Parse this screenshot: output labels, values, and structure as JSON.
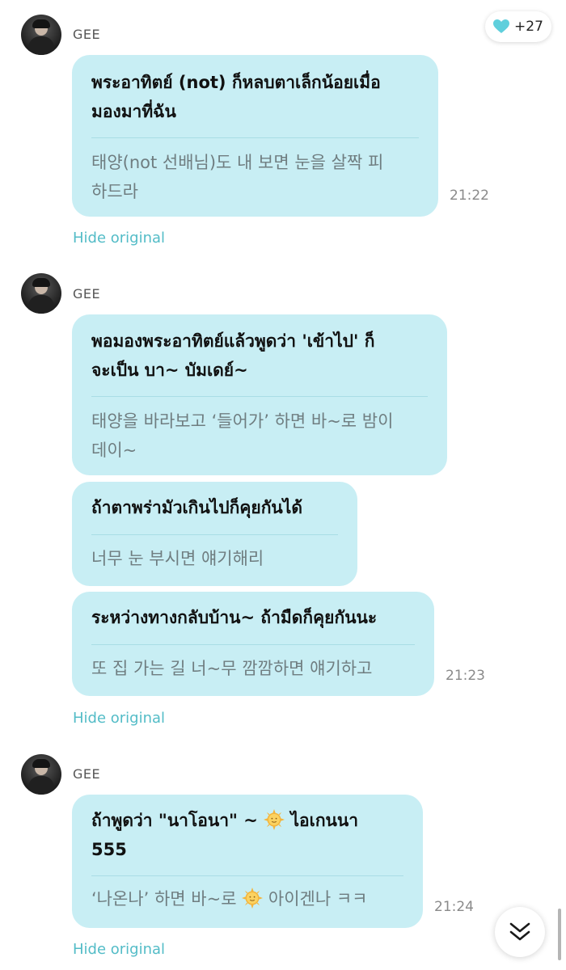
{
  "reactions": {
    "icon": "heart-icon",
    "color": "#5fcfdc",
    "count_label": "+27"
  },
  "hide_original_label": "Hide original",
  "messages": [
    {
      "author": "GEE",
      "time": "21:22",
      "bubbles": [
        {
          "translated": "พระอาทิตย์ (not) ก็หลบตาเล็กน้อยเมื่อ\nมองมาที่ฉัน",
          "original": "태양(not 선배님)도 내 보면 눈을 살짝 피\n하드라"
        }
      ]
    },
    {
      "author": "GEE",
      "time": "21:23",
      "bubbles": [
        {
          "translated": "พอมองพระอาทิตย์แล้วพูดว่า 'เข้าไป' ก็\nจะเป็น บา~ บัมเดย์~",
          "original": "태양을 바라보고 ‘들어가’ 하면 바~로 밤이\n데이~"
        },
        {
          "translated": "ถ้าตาพร่ามัวเกินไปก็คุยกันได้",
          "original": "너무 눈 부시면 얘기해리"
        },
        {
          "translated": "ระหว่างทางกลับบ้าน~ ถ้ามืดก็คุยกันนะ",
          "original": "또 집 가는 길 너~무 깜깜하면 얘기하고"
        }
      ]
    },
    {
      "author": "GEE",
      "time": "21:24",
      "bubbles": [
        {
          "translated_a": "ถ้าพูดว่า \"นาโอนา\" ~ ",
          "translated_b": " ไอเกนนา",
          "translated_c": "555",
          "original_a": "‘나온나’ 하면 바~로 ",
          "original_b": " 아이겐나 ㅋㅋ",
          "emoji": "sun-face-emoji"
        }
      ]
    }
  ],
  "scroll_button": {
    "icon": "double-chevron-down-icon"
  },
  "colors": {
    "bubble": "#c8eef4",
    "link": "#53bcc7",
    "original_text": "#6f7d80"
  }
}
